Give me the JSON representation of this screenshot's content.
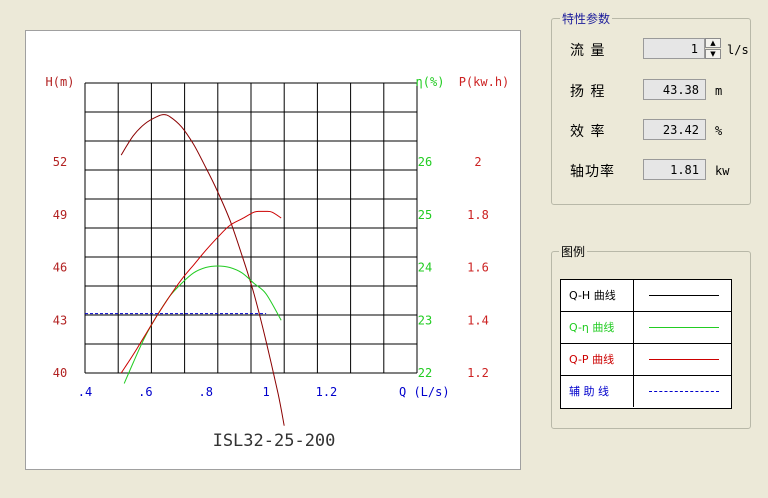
{
  "chart_data": {
    "type": "line",
    "title": "ISL32-25-200",
    "xlabel": "Q (L/s)",
    "xlim": [
      0.4,
      1.5
    ],
    "x_ticks": [
      ".4",
      ".6",
      ".8",
      "1",
      "1.2"
    ],
    "axes": {
      "head": {
        "label": "H(m)",
        "ylim": [
          40,
          56.5
        ],
        "ticks": [
          "40",
          "43",
          "46",
          "49",
          "52"
        ],
        "color": "#b22222"
      },
      "efficiency": {
        "label": "η(%)",
        "ylim": [
          22,
          27.5
        ],
        "ticks": [
          "22",
          "23",
          "24",
          "25",
          "26"
        ],
        "color": "#22cc22"
      },
      "power": {
        "label": "P(kw.h)",
        "ylim": [
          1.2,
          2.3
        ],
        "ticks": [
          "1.2",
          "1.4",
          "1.6",
          "1.8",
          "2"
        ],
        "color": "#cc2222"
      }
    },
    "grid": true,
    "series": [
      {
        "name": "Q-H 曲线",
        "axis": "head",
        "color": "#8b0000",
        "x": [
          0.52,
          0.56,
          0.6,
          0.64,
          0.66,
          0.68,
          0.72,
          0.76,
          0.8,
          0.84,
          0.88,
          0.92,
          0.96,
          1.0,
          1.04,
          1.06
        ],
        "y": [
          52.4,
          53.5,
          54.2,
          54.6,
          54.7,
          54.6,
          54.0,
          53.0,
          51.7,
          50.3,
          48.7,
          46.7,
          44.5,
          41.8,
          38.8,
          37.0
        ]
      },
      {
        "name": "Q-η 曲线",
        "axis": "efficiency",
        "color": "#22cc22",
        "x": [
          0.53,
          0.56,
          0.6,
          0.64,
          0.68,
          0.72,
          0.76,
          0.8,
          0.84,
          0.88,
          0.92,
          0.96,
          1.0,
          1.05
        ],
        "y": [
          21.8,
          22.2,
          22.7,
          23.1,
          23.45,
          23.7,
          23.9,
          24.0,
          24.03,
          24.0,
          23.9,
          23.7,
          23.5,
          23.0
        ]
      },
      {
        "name": "Q-P 曲线",
        "axis": "power",
        "color": "#cc0000",
        "x": [
          0.52,
          0.56,
          0.6,
          0.64,
          0.68,
          0.72,
          0.76,
          0.8,
          0.84,
          0.88,
          0.92,
          0.96,
          0.98,
          1.0,
          1.02,
          1.05
        ],
        "y": [
          1.2,
          1.27,
          1.345,
          1.42,
          1.49,
          1.555,
          1.61,
          1.665,
          1.715,
          1.76,
          1.785,
          1.81,
          1.813,
          1.813,
          1.81,
          1.788
        ]
      },
      {
        "name": "辅助线",
        "axis": "head",
        "color": "#0000cc",
        "dashed": true,
        "x": [
          0.4,
          1.0
        ],
        "y": [
          43.38,
          43.38
        ]
      }
    ]
  },
  "params": {
    "title": "特性参数",
    "flow": {
      "label": "流  量",
      "value": "1",
      "unit": "l/s"
    },
    "head": {
      "label": "扬  程",
      "value": "43.38",
      "unit": "m"
    },
    "efficiency": {
      "label": "效  率",
      "value": "23.42",
      "unit": "%"
    },
    "power": {
      "label": "轴功率",
      "value": "1.81",
      "unit": "kw"
    }
  },
  "legend": {
    "title": "图例",
    "items": [
      {
        "label": "Q-H 曲线",
        "color": "#000000",
        "line_color": "#000000",
        "dashed": false
      },
      {
        "label": "Q-η 曲线",
        "color": "#22cc22",
        "line_color": "#22cc22",
        "dashed": false
      },
      {
        "label": "Q-P 曲线",
        "color": "#cc0000",
        "line_color": "#cc0000",
        "dashed": false
      },
      {
        "label": "辅 助 线",
        "color": "#0000cc",
        "line_color": "#0000cc",
        "dashed": true
      }
    ]
  }
}
